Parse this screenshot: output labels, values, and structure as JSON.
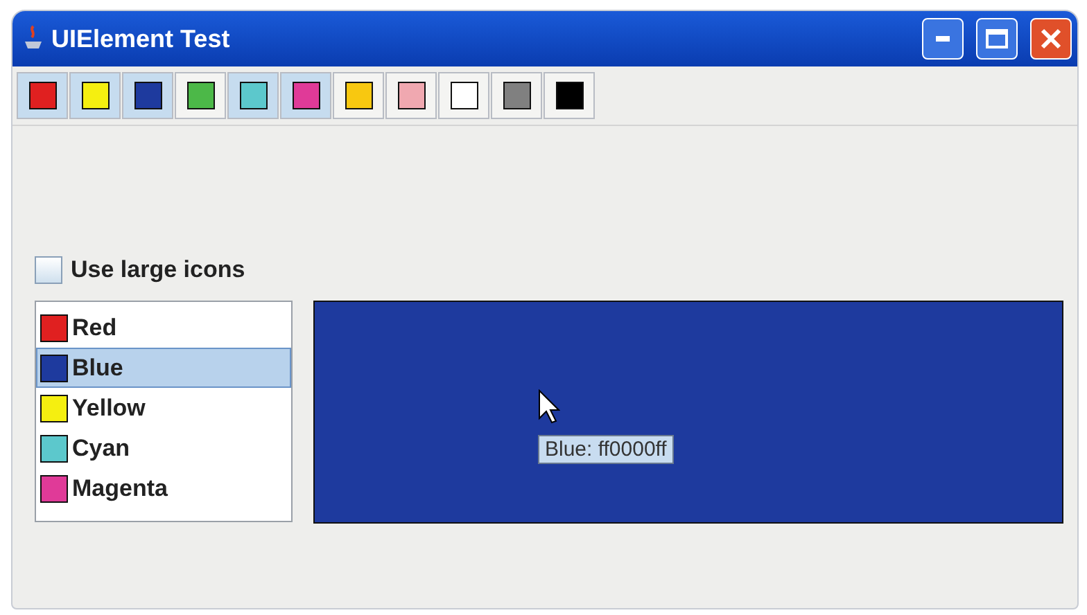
{
  "window": {
    "title": "UIElement Test"
  },
  "toolbar": [
    {
      "color": "#e02020",
      "highlighted": true
    },
    {
      "color": "#f5ef10",
      "highlighted": true
    },
    {
      "color": "#1e3a9e",
      "highlighted": true
    },
    {
      "color": "#4cb848",
      "highlighted": false
    },
    {
      "color": "#5cc8cc",
      "highlighted": true
    },
    {
      "color": "#e03a98",
      "highlighted": true
    },
    {
      "color": "#f8c810",
      "highlighted": false
    },
    {
      "color": "#f0a8b0",
      "highlighted": false
    },
    {
      "color": "#ffffff",
      "highlighted": false
    },
    {
      "color": "#808080",
      "highlighted": false
    },
    {
      "color": "#000000",
      "highlighted": false
    }
  ],
  "large_icons": {
    "label": "Use large icons",
    "checked": false
  },
  "list": [
    {
      "label": "Red",
      "color": "#e02020",
      "selected": false
    },
    {
      "label": "Blue",
      "color": "#1e3a9e",
      "selected": true
    },
    {
      "label": "Yellow",
      "color": "#f5ef10",
      "selected": false
    },
    {
      "label": "Cyan",
      "color": "#5cc8cc",
      "selected": false
    },
    {
      "label": "Magenta",
      "color": "#e03a98",
      "selected": false
    }
  ],
  "preview": {
    "color": "#1e3a9e",
    "tooltip": "Blue: ff0000ff"
  }
}
